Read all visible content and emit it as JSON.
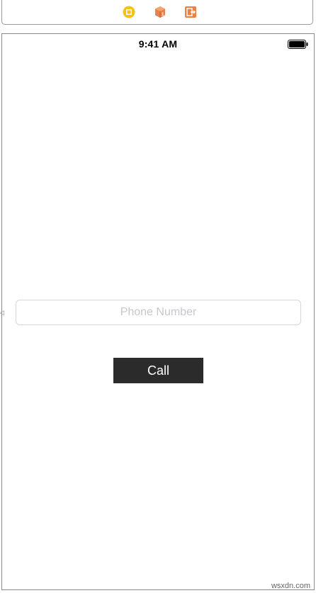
{
  "scene_dock": {
    "icons": [
      {
        "name": "view-controller-icon",
        "color": "#f2c21b"
      },
      {
        "name": "first-responder-icon",
        "color": "#e8824a"
      },
      {
        "name": "exit-icon",
        "color": "#e8824a"
      }
    ]
  },
  "status_bar": {
    "time": "9:41 AM",
    "battery_icon": "battery-full-icon"
  },
  "phone_field": {
    "placeholder": "Phone Number",
    "value": ""
  },
  "call_button": {
    "label": "Call",
    "background": "#2b2b2b",
    "text_color": "#ffffff"
  },
  "watermark": {
    "text": "wsxdn.com"
  }
}
